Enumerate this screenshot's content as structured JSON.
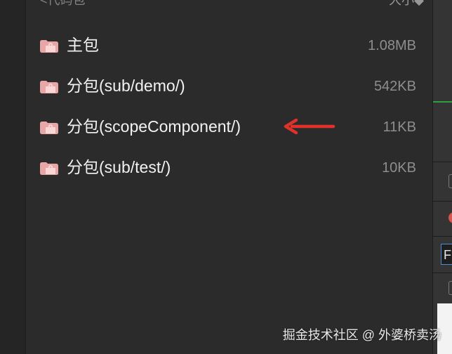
{
  "header": {
    "left_title": "<代码包",
    "right_title": "大小◆"
  },
  "packages": [
    {
      "label": "主包",
      "size": "1.08MB"
    },
    {
      "label": "分包(sub/demo/)",
      "size": "542KB"
    },
    {
      "label": "分包(scopeComponent/)",
      "size": "11KB"
    },
    {
      "label": "分包(sub/test/)",
      "size": "10KB"
    }
  ],
  "right_panel": {
    "input_value": "F"
  },
  "watermark": "掘金技术社区 @ 外婆桥卖汤",
  "colors": {
    "background": "#2b2b2b",
    "folder_icon": "#e8a6a6",
    "arrow": "#e0322a"
  },
  "icons": {
    "package_icon": "folder-icon",
    "pointer_icon": "arrow-left-icon"
  }
}
